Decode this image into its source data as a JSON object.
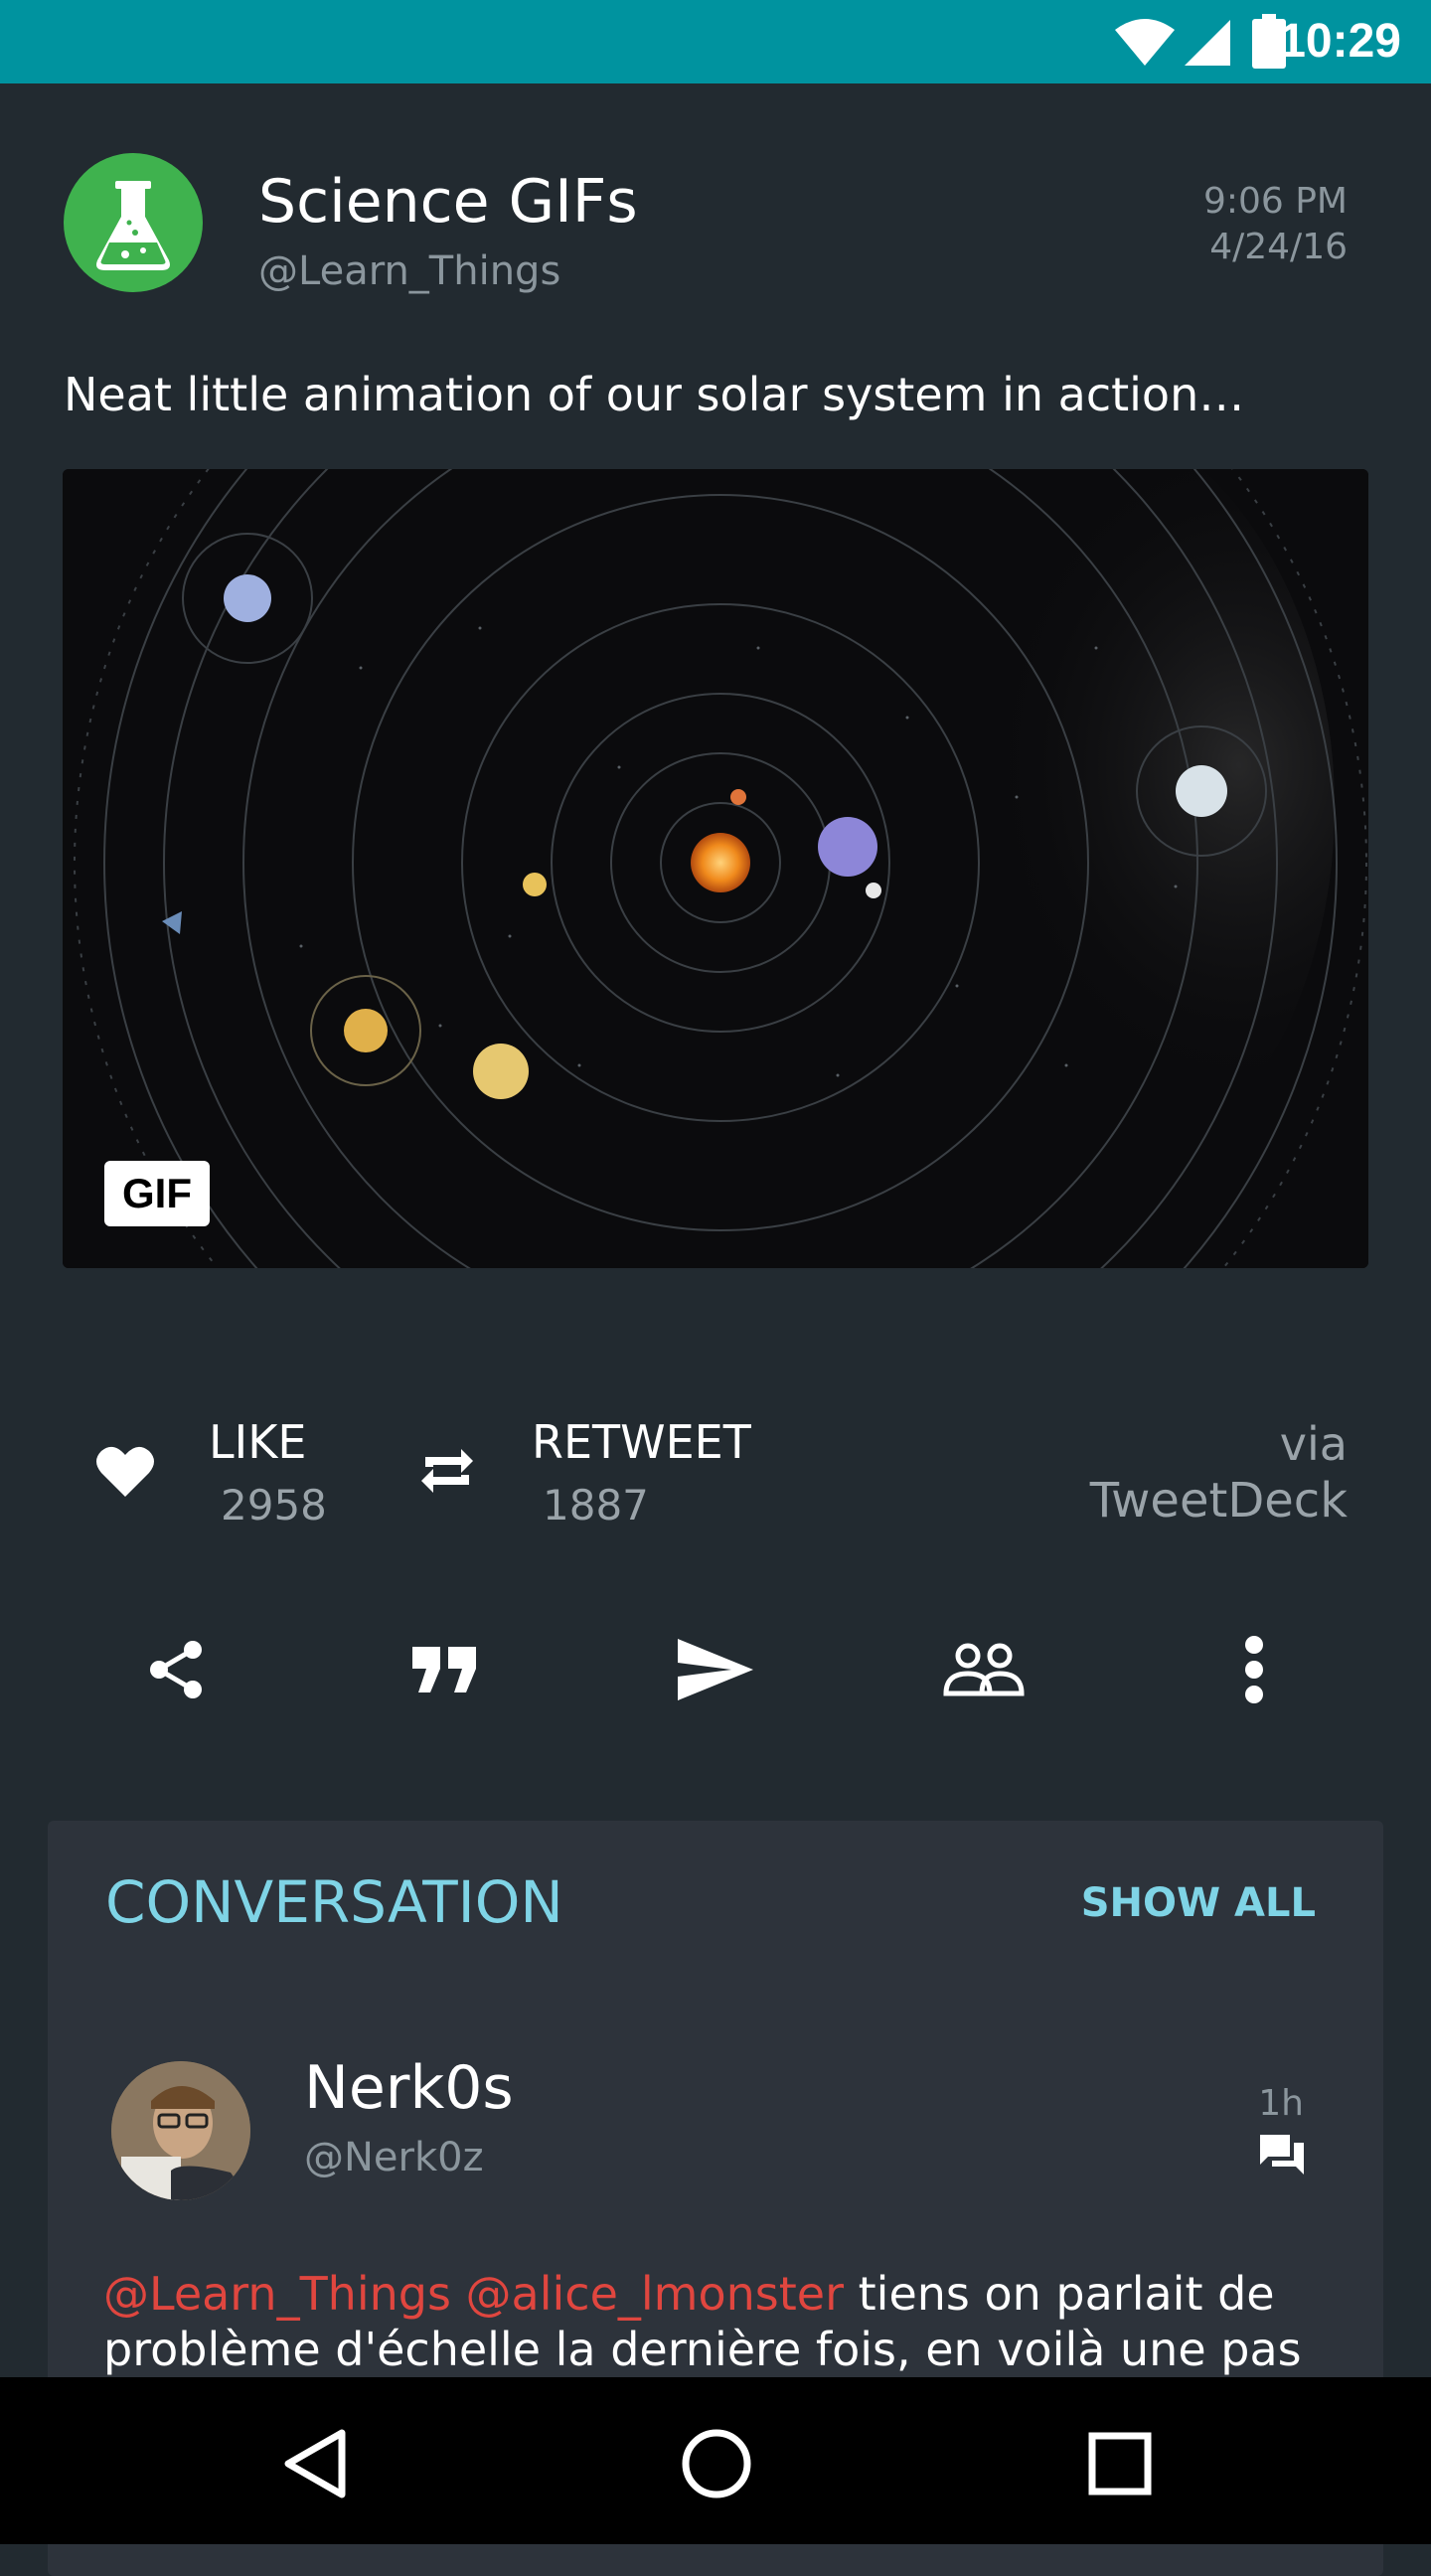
{
  "status_bar": {
    "time": "10:29",
    "icons": [
      "wifi-icon",
      "signal-icon",
      "battery-icon"
    ],
    "color": "#00939f"
  },
  "tweet": {
    "author_name": "Science GIFs",
    "author_handle": "@Learn_Things",
    "time": "9:06 PM",
    "date": "4/24/16",
    "text": "Neat little animation of our solar system in action…",
    "media_badge": "GIF",
    "like_label": "LIKE",
    "like_count": "2958",
    "retweet_label": "RETWEET",
    "retweet_count": "1887",
    "via_label": "via",
    "via_source": "TweetDeck"
  },
  "actions": [
    "share-icon",
    "quote-icon",
    "send-icon",
    "people-icon",
    "more-icon"
  ],
  "conversation": {
    "title": "CONVERSATION",
    "show_all": "SHOW ALL",
    "reply": {
      "name": "Nerk0s",
      "handle": "@Nerk0z",
      "time": "1h",
      "mention1": "@Learn_Things",
      "mention2": "@alice_lmonster",
      "text": " tiens on parlait de problème d'échelle la dernière fois, en voilà une pas mal"
    }
  },
  "colors": {
    "accent": "#7fd4e6",
    "mention": "#e0463f",
    "background": "#222a30",
    "card": "#2d333b"
  }
}
